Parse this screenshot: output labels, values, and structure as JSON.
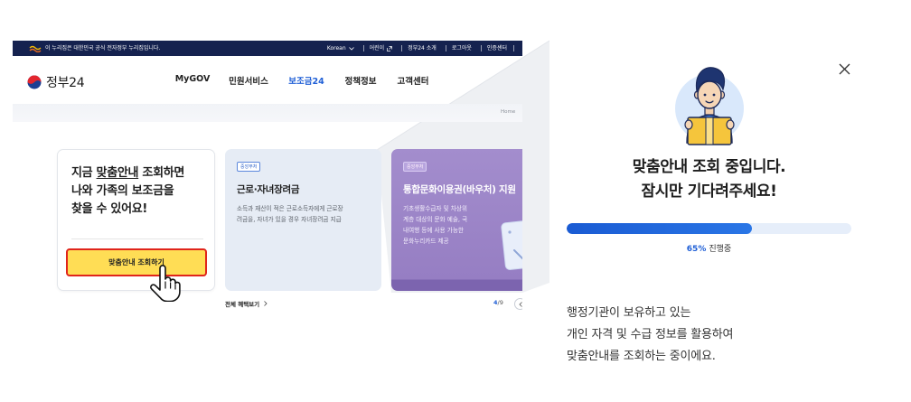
{
  "mini_site": {
    "gov_banner": {
      "notice": "이 누리집은 대한민국 공식 전자정부 누리집입니다.",
      "language": "Korean",
      "links": [
        "어린이",
        "정부24 소개",
        "로그아웃",
        "인증센터"
      ]
    },
    "logo_text": "정부24",
    "nav": {
      "items": [
        "MyGOV",
        "민원서비스",
        "보조금24",
        "정책정보",
        "고객센터"
      ],
      "active_index": 2
    },
    "breadcrumb": "Home",
    "promo_card": {
      "line1_prefix": "지금 ",
      "line1_highlight": "맞춤안내",
      "line1_suffix": " 조회하면",
      "line2": "나와 가족의 보조금을",
      "line3": "찾을 수 있어요!",
      "button_label": "맞춤안내 조회하기"
    },
    "benefit_cards": [
      {
        "badge": "중앙부처",
        "title": "근로·자녀장려금",
        "desc": [
          "소득과 재산이 적은 근로소득자에게 근로장",
          "려금을, 자녀가 있을 경우 자녀장려금 지급"
        ]
      },
      {
        "badge": "중앙부처",
        "title": "통합문화이용권(바우처) 지원",
        "desc": [
          "기초생활수급자 및 차상위",
          "계층 대상의 문화 예술, 국",
          "내여행 등에 사용 가능한",
          "문화누리카드 제공"
        ]
      }
    ],
    "view_all_label": "전체 혜택보기",
    "pager": {
      "current": "4",
      "separator": "/",
      "total": "9"
    }
  },
  "modal": {
    "title_line1": "맞춤안내 조회 중입니다.",
    "title_line2": "잠시만 기다려주세요!",
    "progress": {
      "percent": 65,
      "percent_label": "65%",
      "status": "진행중"
    },
    "description": [
      "행정기관이 보유하고 있는",
      "개인 자격 및 수급 정보를 활용하여",
      "맞춤안내를 조회하는 중이에요."
    ]
  },
  "icons": {
    "gov_emblem": "gov-emblem-icon",
    "logo": "gov24-logo-icon",
    "language": "chevron-down-icon",
    "kids_link": "external-link-icon",
    "cursor": "hand-pointer-icon",
    "view_all": "chevron-right-icon",
    "pager_prev": "chevron-left-icon",
    "close": "close-icon",
    "loading_illustration": "man-holding-box-illustration",
    "card_illustration": "culture-card-illustration"
  },
  "colors": {
    "banner_bg": "#15224f",
    "accent_blue": "#1f5fd6",
    "button_yellow": "#ffdd55",
    "highlight_red": "#e0251b",
    "blue_card": "#e6ecf5",
    "progress_track": "#e6eefa",
    "progress_fill": "#2a76e6"
  }
}
